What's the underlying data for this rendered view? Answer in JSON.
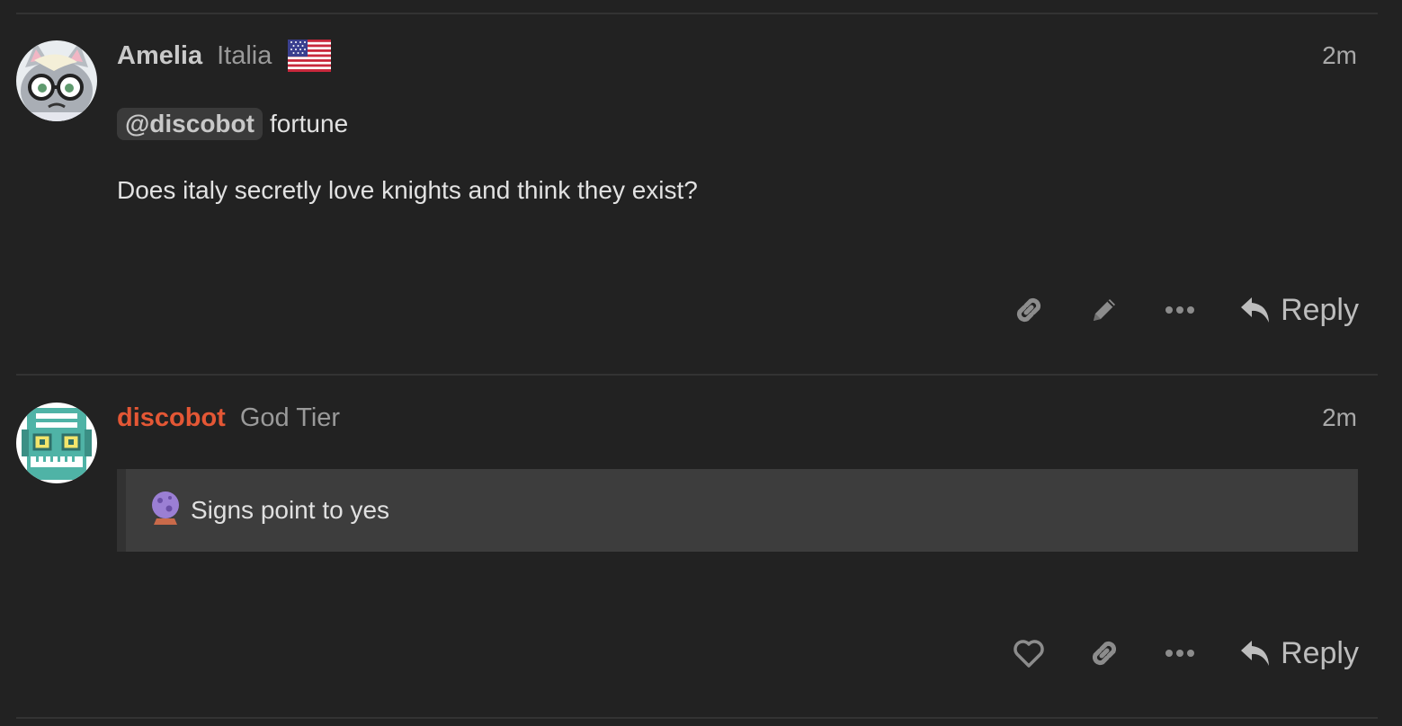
{
  "posts": [
    {
      "username": "Amelia",
      "user_title": "Italia",
      "flag_icon": "us-flag-icon",
      "time": "2m",
      "mention": "@discobot",
      "mention_tail": "fortune",
      "body": "Does italy secretly love knights and think they exist?",
      "actions": [
        "link-icon",
        "pencil-icon",
        "ellipsis-icon"
      ],
      "reply_label": "Reply"
    },
    {
      "username": "discobot",
      "user_title": "God Tier",
      "time": "2m",
      "quote_icon": "crystal-ball-icon",
      "quote_text": "Signs point to yes",
      "actions": [
        "heart-icon",
        "link-icon",
        "ellipsis-icon"
      ],
      "reply_label": "Reply"
    }
  ],
  "colors": {
    "background": "#222222",
    "bot_name": "#e45735",
    "quote_bg": "#3d3d3d"
  }
}
